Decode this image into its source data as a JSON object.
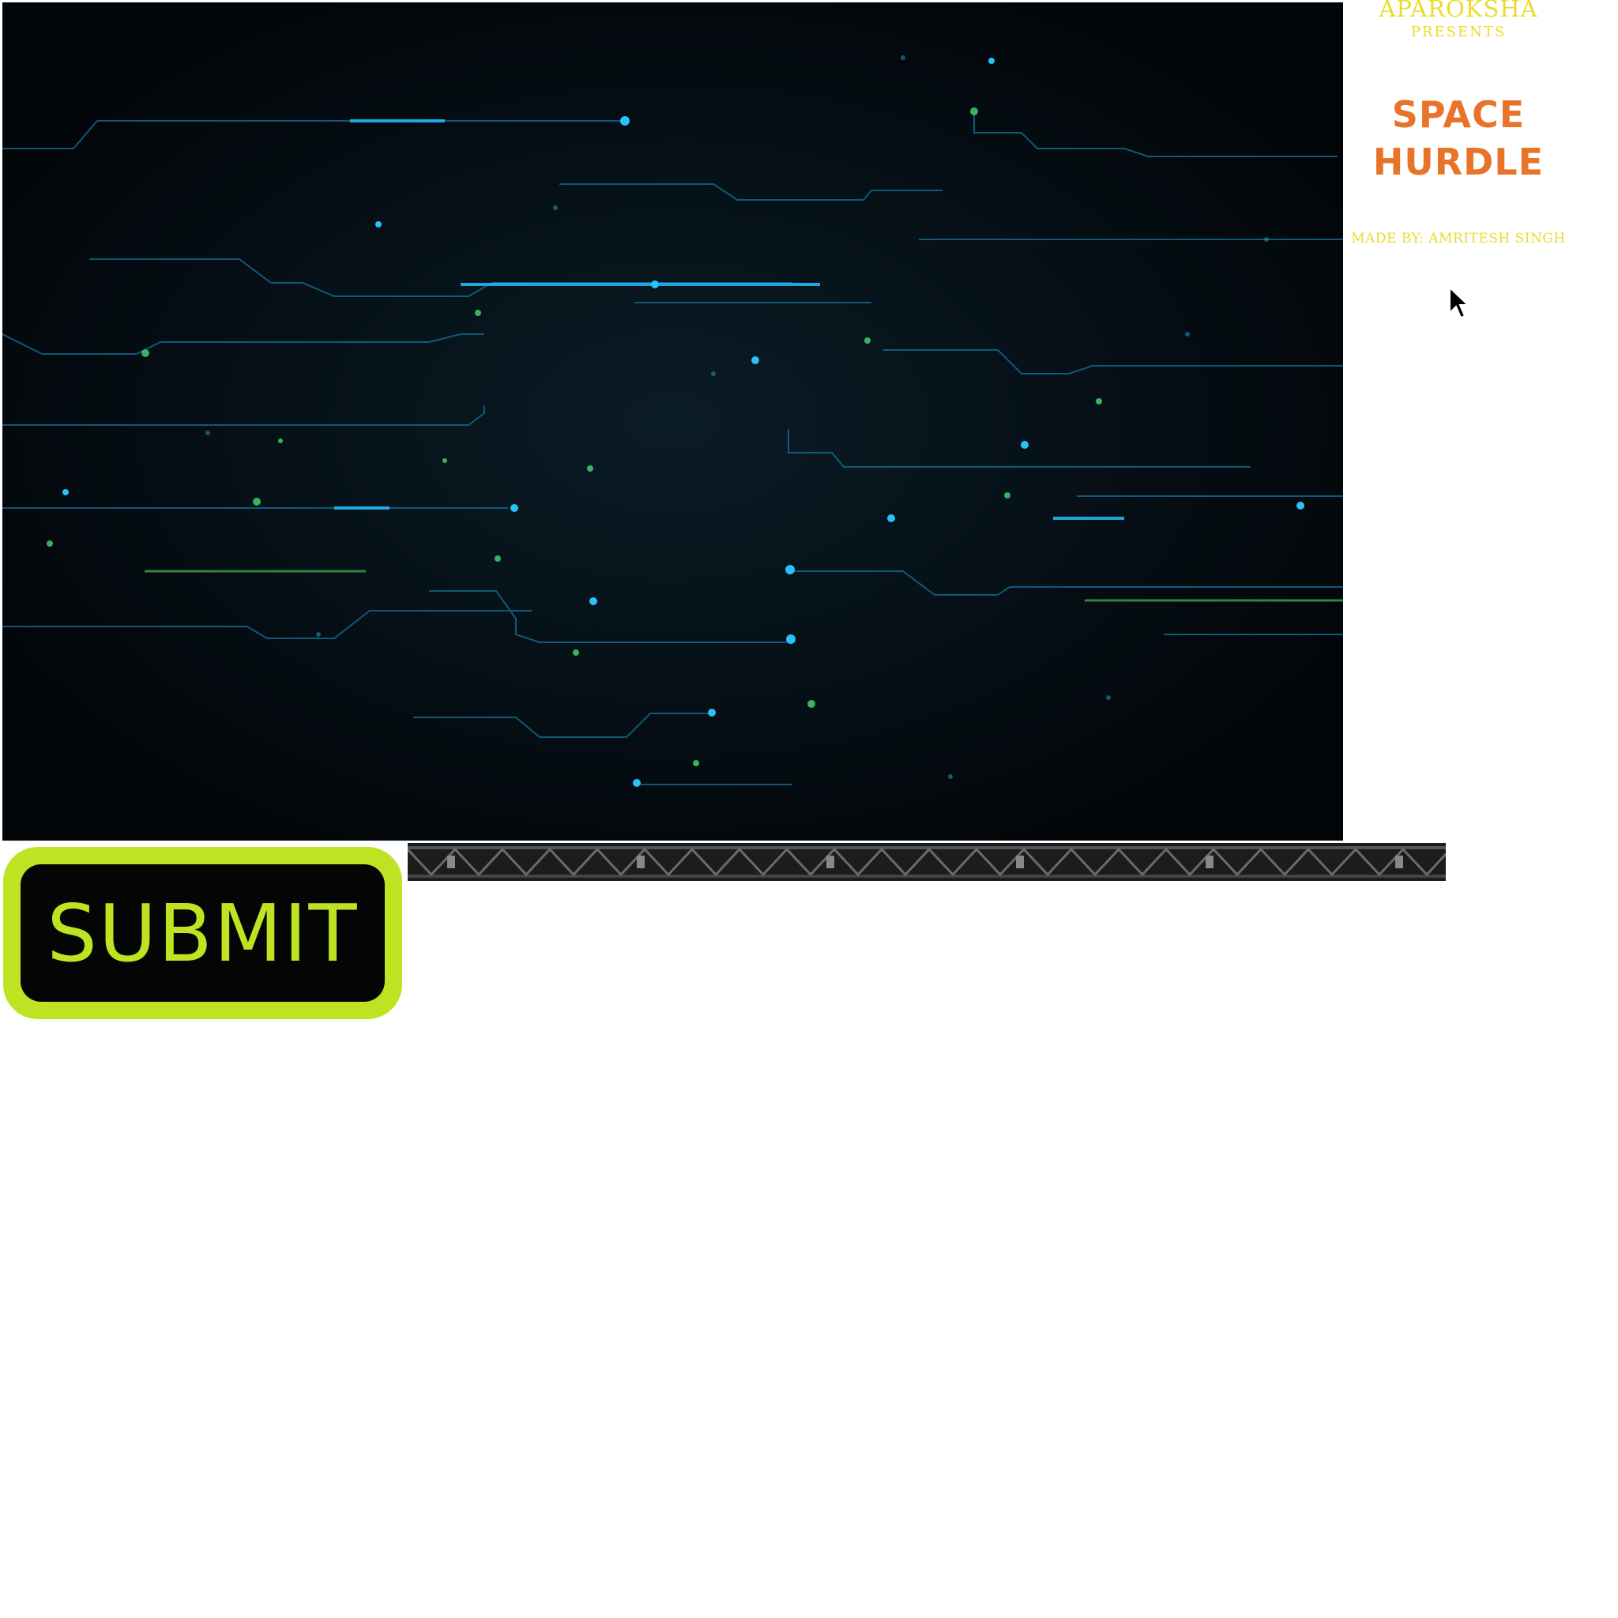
{
  "header": {
    "presenter": "APAROKSHA",
    "presents": "PRESENTS",
    "title_line1": "SPACE",
    "title_line2": "HURDLE",
    "credit": "MADE BY: AMRITESH SINGH"
  },
  "controls": {
    "submit_label": "SUBMIT"
  },
  "colors": {
    "title": "#e8742a",
    "credit": "#eadc2a",
    "button_accent": "#bde323",
    "canvas_bg": "#03070b",
    "circuit_blue": "#1fa6e0",
    "circuit_green": "#3fcf6e"
  },
  "icons": {
    "cursor": "mouse-pointer-icon"
  }
}
